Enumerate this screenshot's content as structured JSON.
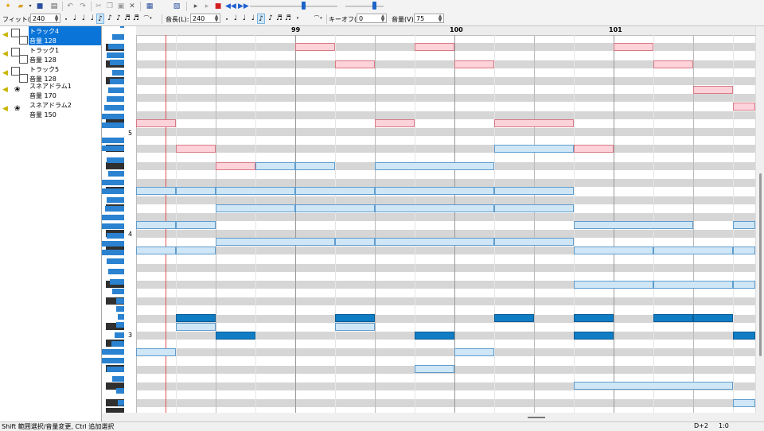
{
  "toolbar1": {
    "icons": [
      "new-file-icon",
      "open-folder-icon",
      "save-icon",
      "print-icon",
      "undo-icon",
      "redo-icon",
      "cut-icon",
      "copy-icon",
      "paste-icon",
      "delete-icon",
      "properties-icon",
      "window-icon",
      "play-icon",
      "step-icon",
      "stop-icon",
      "rewind-icon",
      "fast-forward-icon"
    ],
    "tempo_level": 0.62,
    "volume_level": 0.8
  },
  "toolbar2": {
    "fit_label": "フィット(F):",
    "fit_value": "240",
    "length_label": "音長(L):",
    "length_value": "240",
    "keyoff_label": "キーオフ(K):",
    "keyoff_value": "0",
    "volume_label": "音量(V):",
    "volume_value": "75"
  },
  "tracks": [
    {
      "name": "トラック4",
      "volume": "音量 128",
      "selected": true,
      "type": "melody"
    },
    {
      "name": "トラック1",
      "volume": "音量 128",
      "selected": false,
      "type": "melody"
    },
    {
      "name": "トラック5",
      "volume": "音量 128",
      "selected": false,
      "type": "melody"
    },
    {
      "name": "スネアドラム1",
      "volume": "音量 170",
      "selected": false,
      "type": "drum"
    },
    {
      "name": "スネアドラム2",
      "volume": "音量 150",
      "selected": false,
      "type": "drum"
    }
  ],
  "keyboard": {
    "octave_labels": [
      "5",
      "4",
      "3"
    ]
  },
  "ruler": {
    "measures": [
      "99",
      "100",
      "101"
    ]
  },
  "status": {
    "hint": "Shift 範囲選択/音量変更, Ctrl 追加選択",
    "note": "D+2",
    "position": "1:0"
  },
  "colors": {
    "pink_note": "#fdd2d8",
    "light_blue_note": "#cfe6f6",
    "dark_blue_note": "#0f7cc4",
    "selection": "#0a74d8"
  }
}
